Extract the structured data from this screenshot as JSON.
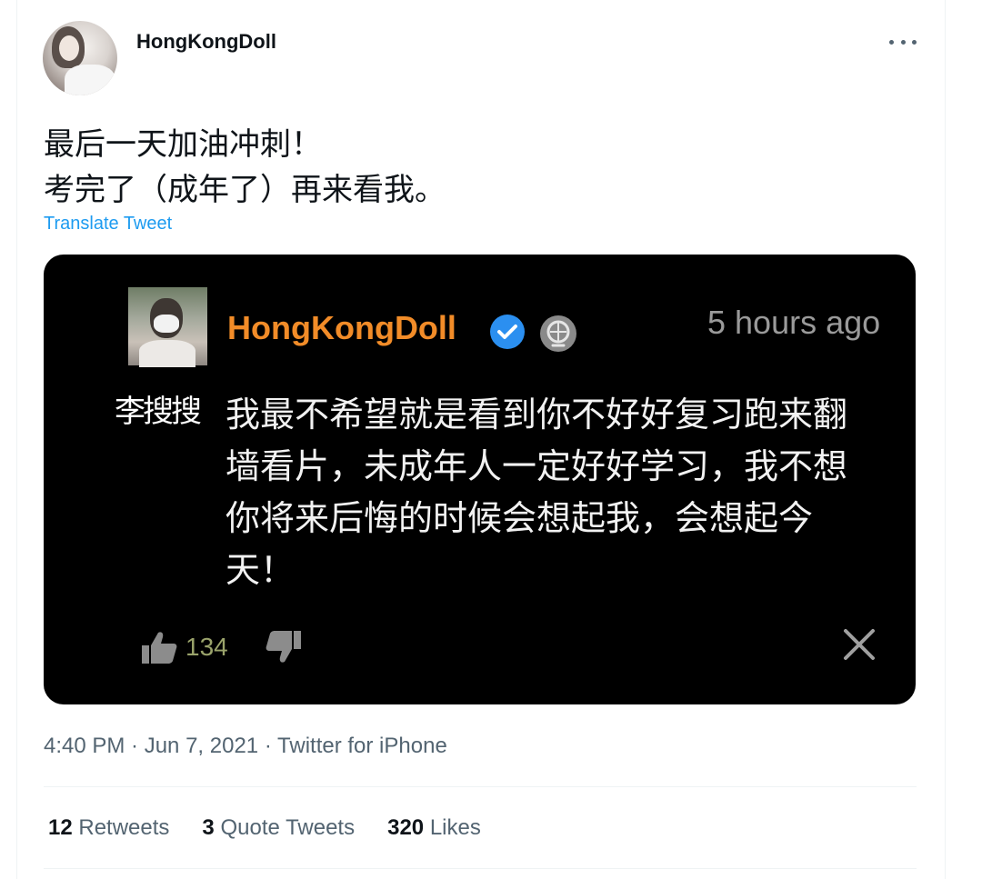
{
  "author": {
    "display_name": "HongKongDoll"
  },
  "tweet": {
    "text_line1": "最后一天加油冲刺！",
    "text_line2": "考完了（成年了）再来看我。",
    "translate_label": "Translate Tweet"
  },
  "media": {
    "name": "HongKongDoll",
    "time": "5 hours ago",
    "watermark": "李搜搜",
    "comment": "我最不希望就是看到你不好好复习跑来翻墙看片，未成年人一定好好学习，我不想你将来后悔的时候会想起我，会想起今天！",
    "like_count": "134",
    "icons": [
      "verified-icon",
      "globe-icon",
      "thumbs-up-icon",
      "thumbs-down-icon",
      "close-icon"
    ]
  },
  "meta": {
    "timestamp": "4:40 PM · Jun 7, 2021 · Twitter for iPhone"
  },
  "stats": {
    "retweets_count": "12",
    "retweets_label": "Retweets",
    "quotes_count": "3",
    "quotes_label": "Quote Tweets",
    "likes_count": "320",
    "likes_label": "Likes"
  },
  "colors": {
    "link": "#1d9bf0",
    "inner_name": "#f28c28",
    "verified": "#1d9bf0"
  }
}
